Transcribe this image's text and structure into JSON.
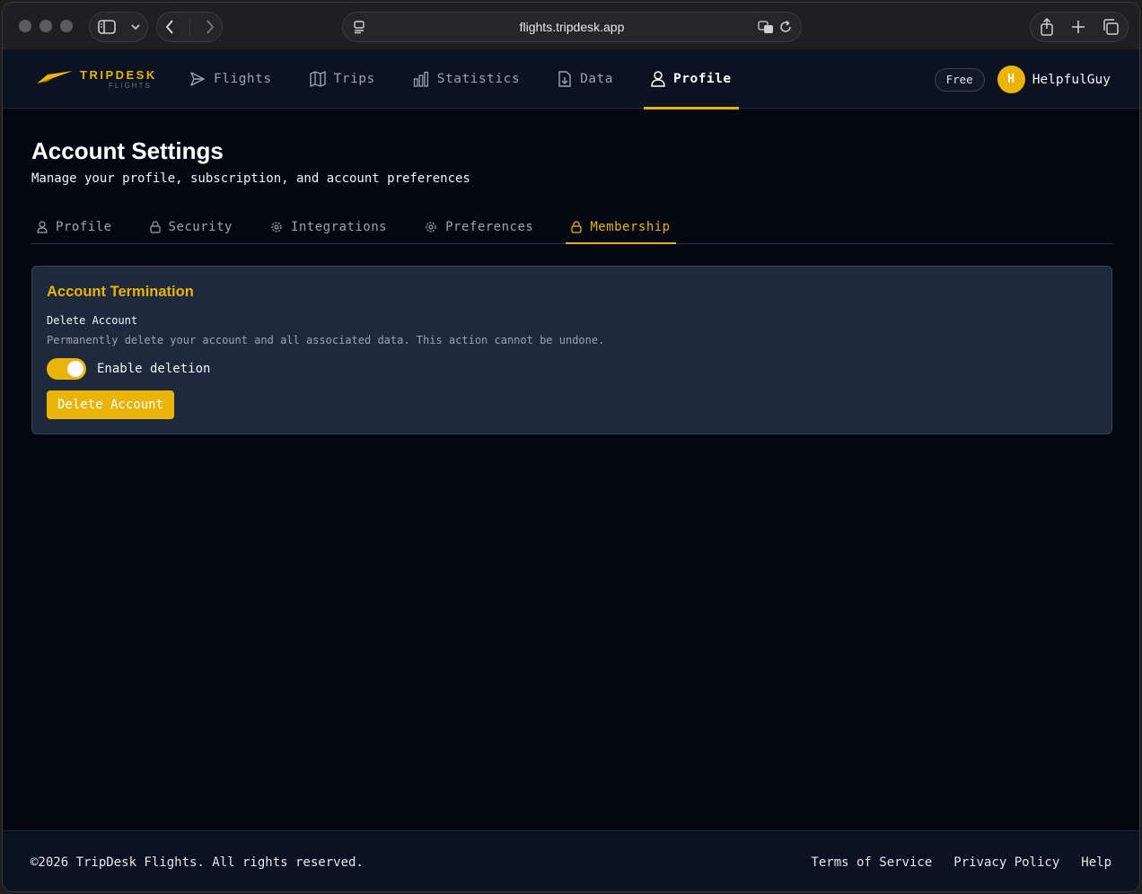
{
  "browser": {
    "url": "flights.tripdesk.app"
  },
  "header": {
    "brand": "TRIPDESK",
    "brand_sub": "FLIGHTS",
    "nav": [
      {
        "label": "Flights",
        "icon": "paper-plane-icon",
        "active": false
      },
      {
        "label": "Trips",
        "icon": "map-icon",
        "active": false
      },
      {
        "label": "Statistics",
        "icon": "bar-chart-icon",
        "active": false
      },
      {
        "label": "Data",
        "icon": "file-download-icon",
        "active": false
      },
      {
        "label": "Profile",
        "icon": "user-icon",
        "active": true
      }
    ],
    "plan_badge": "Free",
    "avatar_initial": "H",
    "username": "HelpfulGuy"
  },
  "page": {
    "title": "Account Settings",
    "subtitle": "Manage your profile, subscription, and account preferences"
  },
  "tabs": [
    {
      "label": "Profile",
      "icon": "user-icon",
      "active": false
    },
    {
      "label": "Security",
      "icon": "lock-icon",
      "active": false
    },
    {
      "label": "Integrations",
      "icon": "gear-icon",
      "active": false
    },
    {
      "label": "Preferences",
      "icon": "gear-icon",
      "active": false
    },
    {
      "label": "Membership",
      "icon": "lock-icon",
      "active": true
    }
  ],
  "card": {
    "title": "Account Termination",
    "section_label": "Delete Account",
    "section_desc": "Permanently delete your account and all associated data. This action cannot be undone.",
    "toggle_label": "Enable deletion",
    "toggle_on": true,
    "button_label": "Delete Account"
  },
  "footer": {
    "copyright": "©2026 TripDesk Flights. All rights reserved.",
    "links": [
      "Terms of Service",
      "Privacy Policy",
      "Help"
    ]
  },
  "colors": {
    "accent": "#eab308",
    "background": "#030712",
    "card": "#1e293b"
  }
}
